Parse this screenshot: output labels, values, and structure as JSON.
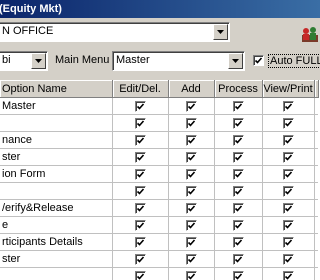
{
  "window": {
    "title": "(Equity Mkt)"
  },
  "branch": {
    "value": "N OFFICE"
  },
  "user_select": {
    "value": "bi"
  },
  "main_menu": {
    "label": "Main Menu",
    "value": "Master"
  },
  "auto_full": {
    "label": "Auto FULL L",
    "checked": true
  },
  "grid": {
    "columns": [
      "Option Name",
      "Edit/Del.",
      "Add",
      "Process",
      "View/Print",
      ""
    ],
    "rows": [
      {
        "name": "Master",
        "edit": true,
        "add": true,
        "process": true,
        "view": true
      },
      {
        "name": "",
        "edit": true,
        "add": true,
        "process": true,
        "view": true
      },
      {
        "name": "nance",
        "edit": true,
        "add": true,
        "process": true,
        "view": true
      },
      {
        "name": "ster",
        "edit": true,
        "add": true,
        "process": true,
        "view": true
      },
      {
        "name": "ion Form",
        "edit": true,
        "add": true,
        "process": true,
        "view": true
      },
      {
        "name": "",
        "edit": true,
        "add": true,
        "process": true,
        "view": true
      },
      {
        "name": "/erify&Release",
        "edit": true,
        "add": true,
        "process": true,
        "view": true
      },
      {
        "name": "e",
        "edit": true,
        "add": true,
        "process": true,
        "view": true
      },
      {
        "name": "rticipants Details",
        "edit": true,
        "add": true,
        "process": true,
        "view": true
      },
      {
        "name": "ster",
        "edit": true,
        "add": true,
        "process": true,
        "view": true
      },
      {
        "name": "",
        "edit": true,
        "add": true,
        "process": true,
        "view": true
      }
    ]
  }
}
